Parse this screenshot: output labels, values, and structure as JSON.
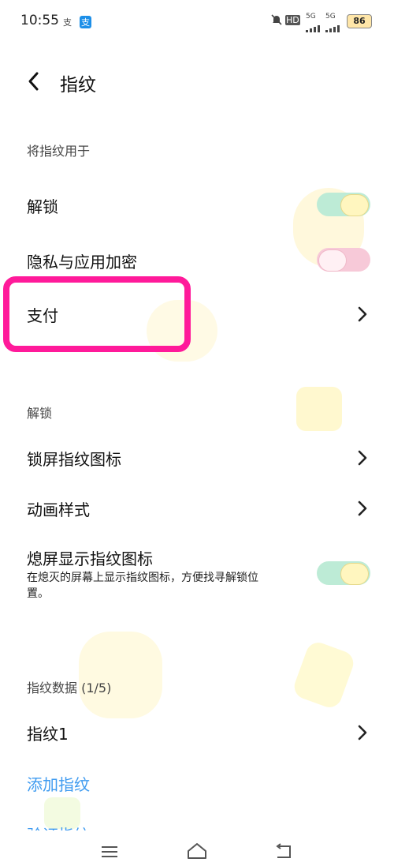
{
  "status_bar": {
    "time": "10:55",
    "app_icons": [
      "支",
      "支"
    ],
    "signal_labels": [
      "HD",
      "5G",
      "5G"
    ],
    "battery": "86"
  },
  "header": {
    "title": "指纹"
  },
  "sections": {
    "use_for_title": "将指纹用于",
    "unlock_item": "解锁",
    "privacy_item": "隐私与应用加密",
    "payment_item": "支付",
    "unlock_section_title": "解锁",
    "lockscreen_icon_item": "锁屏指纹图标",
    "animation_item": "动画样式",
    "screen_off_item": "熄屏显示指纹图标",
    "screen_off_desc": "在熄灭的屏幕上显示指纹图标，方便找寻解锁位置。",
    "data_title": "指纹数据 (1/5)",
    "fingerprint1_item": "指纹1",
    "add_fingerprint": "添加指纹",
    "verify_fingerprint": "验证指纹"
  },
  "toggles": {
    "unlock": true,
    "privacy": false,
    "screen_off": true
  },
  "colors": {
    "toggle_on": "#bdebd6",
    "toggle_off": "#f7c9d8",
    "highlight": "#ff1a9a",
    "link": "#3f9bf0"
  }
}
